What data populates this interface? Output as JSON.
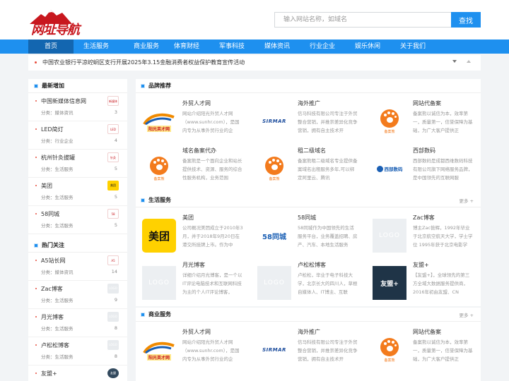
{
  "header": {
    "logo_text": "网址导航",
    "search_placeholder": "输入网站名称，如域名",
    "search_button": "查找"
  },
  "nav": [
    "首页",
    "生活服务",
    "商业服务",
    "体育财经",
    "军事科技",
    "媒体资讯",
    "行业企业",
    "娱乐休闲",
    "关于我们"
  ],
  "notice": "中国农业银行平凉崆峒区支行开展2025年3.15金融消费者权益保护教育宣传活动",
  "sidebar": {
    "latest_title": "最新增加",
    "latest": [
      {
        "name": "中国新媒体信息网",
        "cat": "分类：媒体资讯",
        "count": "3",
        "icon_text": "新媒体"
      },
      {
        "name": "LED简灯",
        "cat": "分类：行业企业",
        "count": "4",
        "icon_text": "LED"
      },
      {
        "name": "杭州针灸拔罐",
        "cat": "分类：生活服务",
        "count": "5",
        "icon_text": "针灸"
      },
      {
        "name": "美团",
        "cat": "分类：生活服务",
        "count": "5",
        "icon_text": "美团"
      },
      {
        "name": "58同城",
        "cat": "分类：生活服务",
        "count": "5",
        "icon_text": "58"
      }
    ],
    "hot_title": "热门关注",
    "hot": [
      {
        "name": "A5站长网",
        "cat": "分类：媒体资讯",
        "count": "14",
        "icon_text": "A5"
      },
      {
        "name": "Zac博客",
        "cat": "分类：生活服务",
        "count": "9",
        "icon_text": "LOGO"
      },
      {
        "name": "月光博客",
        "cat": "分类：生活服务",
        "count": "8",
        "icon_text": "LOGO"
      },
      {
        "name": "卢松松博客",
        "cat": "分类：生活服务",
        "count": "8",
        "icon_text": "LOGO"
      },
      {
        "name": "友盟+",
        "cat": "",
        "count": "",
        "icon_text": "友盟"
      }
    ]
  },
  "sections": [
    {
      "title": "品牌推荐",
      "more": "",
      "cards": [
        {
          "title": "外贸人才网",
          "desc": "网站介绍阳光外贸人才网（www.sunhr.com），是国内专为从事外贸行业的企",
          "logo": "sunhr"
        },
        {
          "title": "海外推广",
          "desc": "信马科技有限公司专注于外贸整合营销，并推崇差异化竞争营销，拥有自主技术开",
          "logo": "sirmar"
        },
        {
          "title": "网站代备案",
          "desc": "备案熊以诚信为本，效率第一，质量第一，信誉保障为基础，为广大客户提供正",
          "logo": "paw"
        },
        {
          "title": "域名备案代办",
          "desc": "备案熊是一个面向企业和站长提供技术、资源、服务的综合性服务机构，业务范围",
          "logo": "paw"
        },
        {
          "title": "租二级域名",
          "desc": "备案熊租二级域名专业提供备案域名出租服务多年,可以绑定阿里云、腾讯",
          "logo": "paw"
        },
        {
          "title": "西部数码",
          "desc": "西部数码是成都西维数码科技有限公司旗下网络服务品牌，是中国领先的互联网服",
          "logo": "west"
        }
      ]
    },
    {
      "title": "生活服务",
      "more": "更多 +",
      "cards": [
        {
          "title": "美团",
          "desc": "公司概况美团成立于2010年3月，并于2018年9月20日在港交所挂牌上市。作为中",
          "logo": "meituan"
        },
        {
          "title": "58同城",
          "desc": "58同城作为中国领先的生活服务平台，业务覆盖招聘、房产、汽车、本地生活服务",
          "logo": "58"
        },
        {
          "title": "Zac博客",
          "desc": "博主Zac昝辉，1992年毕业于北京航空航天大学，学士学位 1995年获于北京电影学",
          "logo": "placeholder"
        },
        {
          "title": "月光博客",
          "desc": "详细介绍月光博客，是一个以IT评论电脑技术和互联网科技为主的个人IT评论博客，",
          "logo": "placeholder"
        },
        {
          "title": "卢松松博客",
          "desc": "卢松松，毕业于电子科技大学，北京长大的四川人，草根自媒体人、IT博主、互联",
          "logo": "placeholder"
        },
        {
          "title": "友盟+",
          "desc": "【友盟+】，全球领先的第三方全域大数据服务提供商，2016年初由友盟、CN",
          "logo": "umeng"
        }
      ]
    },
    {
      "title": "商业服务",
      "more": "更多 +",
      "cards": [
        {
          "title": "外贸人才网",
          "desc": "网站介绍阳光外贸人才网（www.sunhr.com），是国内专为从事外贸行业的企",
          "logo": "sunhr"
        },
        {
          "title": "海外推广",
          "desc": "信马科技有限公司专注于外贸整合营销，并推崇差异化竞争营销，拥有自主技术开",
          "logo": "sirmar"
        },
        {
          "title": "网站代备案",
          "desc": "备案熊以诚信为本，效率第一，质量第一，信誉保障为基础，为广大客户提供正",
          "logo": "paw"
        }
      ]
    }
  ],
  "logo_labels": {
    "sunhr": "阳光英才网",
    "sirmar": "SIRMAR",
    "paw": "备案熊",
    "west": "西部数码",
    "meituan": "美团",
    "58": "58同城",
    "placeholder": "LOGO",
    "umeng": "友盟+"
  },
  "colors": {
    "primary": "#1e90ef",
    "nav_active": "#1366b0",
    "brand_red": "#c8171e",
    "paw_orange": "#f37b1d",
    "meituan_yellow": "#ffd100"
  }
}
